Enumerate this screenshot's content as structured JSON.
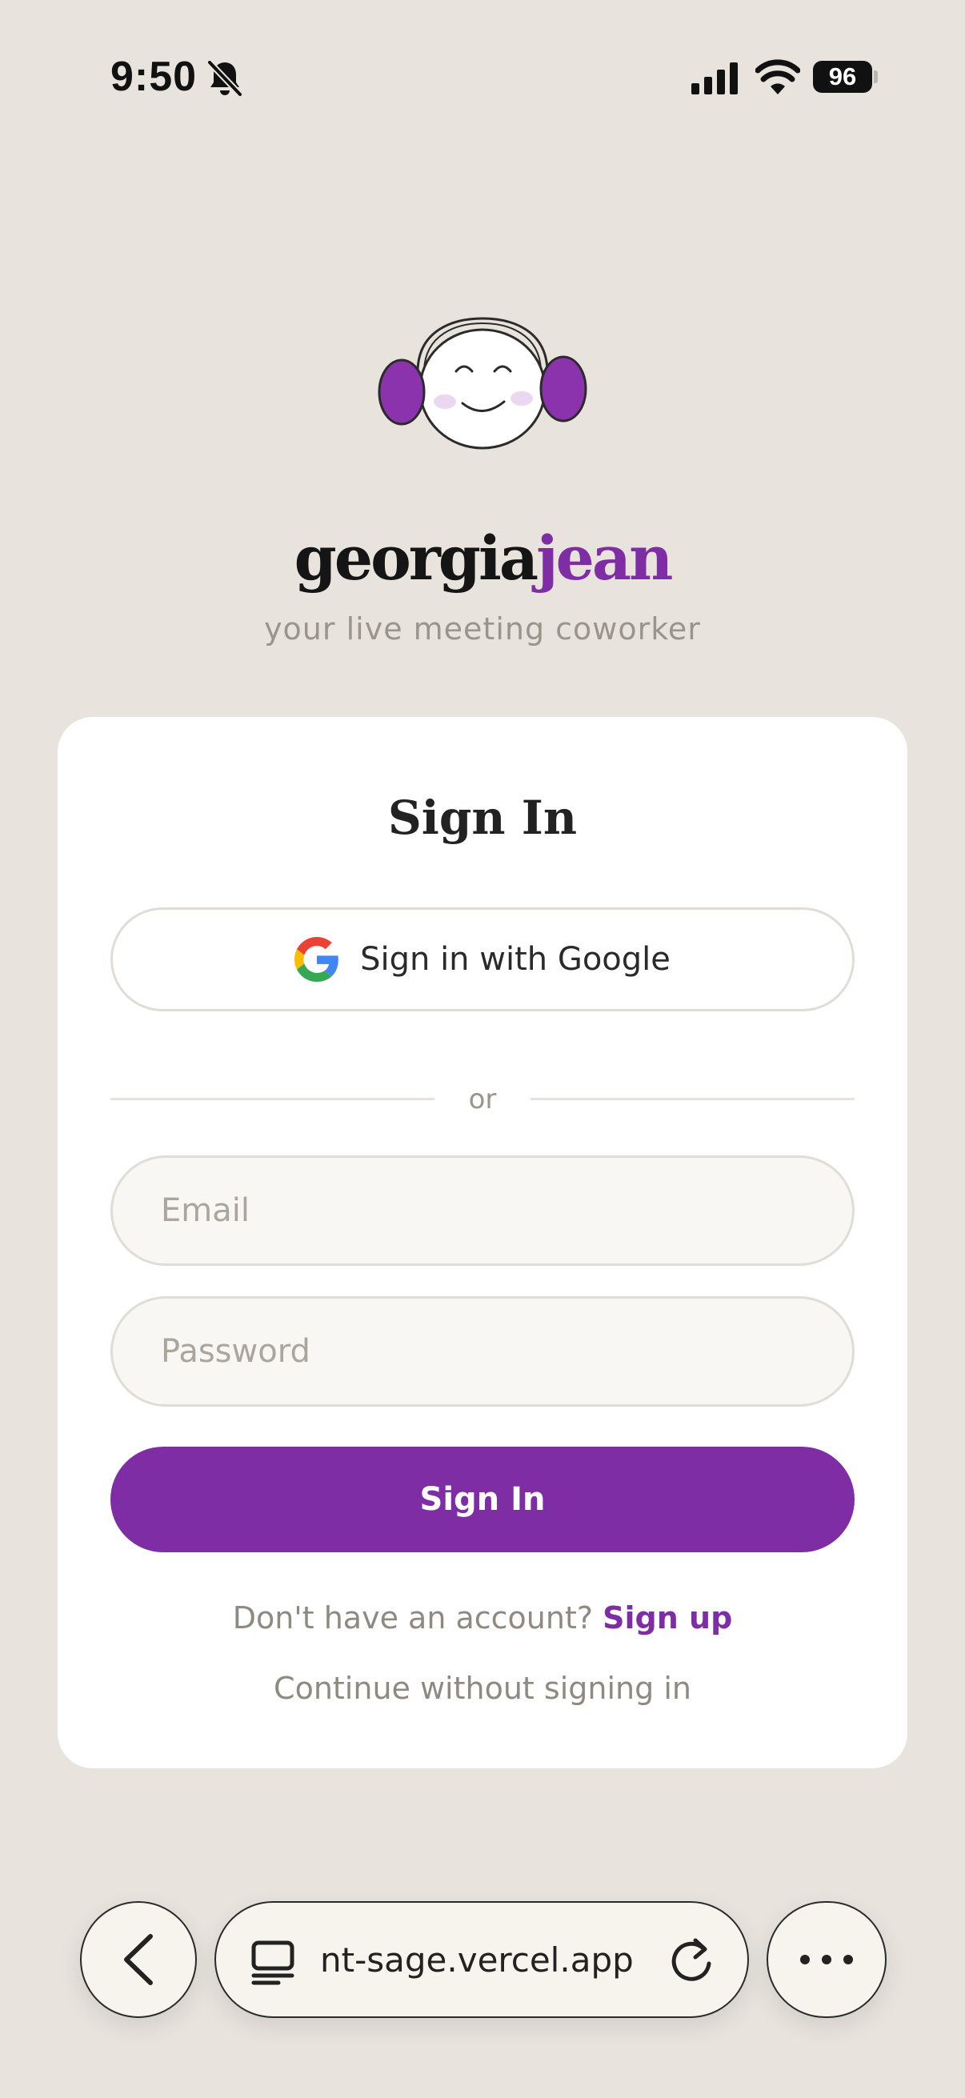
{
  "status_bar": {
    "time": "9:50",
    "battery": "96",
    "icons": [
      "bell-slash-icon",
      "cellular-signal-icon",
      "wifi-icon",
      "battery-icon"
    ]
  },
  "brand": {
    "name_primary": "georgia",
    "name_accent": "jean",
    "tagline": "your live meeting coworker",
    "accent_color": "#7f2da5"
  },
  "signin_card": {
    "title": "Sign In",
    "google_button_label": "Sign in with Google",
    "divider_text": "or",
    "email_placeholder": "Email",
    "password_placeholder": "Password",
    "submit_label": "Sign In",
    "signup_prompt": "Don't have an account?",
    "signup_link": "Sign up",
    "continue_link": "Continue without signing in"
  },
  "browser_toolbar": {
    "url": "nt-sage.vercel.app",
    "icons": [
      "back-chevron-icon",
      "tabs-icon",
      "reload-icon",
      "more-icon"
    ]
  }
}
